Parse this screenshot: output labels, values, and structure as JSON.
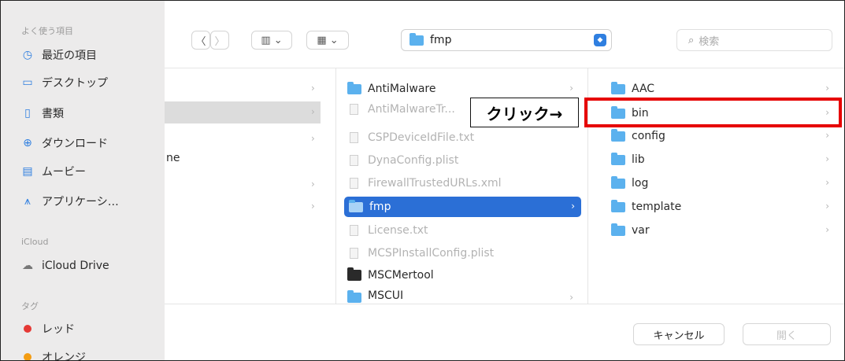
{
  "sidebar": {
    "favorites_header": "よく使う項目",
    "favorites": [
      {
        "label": "最近の項目",
        "icon": "clock-icon"
      },
      {
        "label": "デスクトップ",
        "icon": "desktop-icon"
      },
      {
        "label": "書類",
        "icon": "document-icon"
      },
      {
        "label": "ダウンロード",
        "icon": "download-icon"
      },
      {
        "label": "ムービー",
        "icon": "film-icon"
      },
      {
        "label": "アプリケーシ…",
        "icon": "applications-icon"
      }
    ],
    "icloud_header": "iCloud",
    "icloud": [
      {
        "label": "iCloud Drive",
        "icon": "cloud-icon"
      }
    ],
    "tags_header": "タグ",
    "tags": [
      {
        "label": "レッド",
        "color": "#e53935"
      },
      {
        "label": "オレンジ",
        "color": "#f39c12"
      }
    ]
  },
  "toolbar": {
    "back": "〈",
    "forward": "〉",
    "view_mode": "▥ ⌄",
    "group": "▦ ⌄",
    "path_value": "fmp",
    "search_placeholder": "検索"
  },
  "columns": {
    "col1_partial_label": "ne",
    "col2": [
      {
        "label": "AntiMalware",
        "type": "folder",
        "dim": false,
        "chevron": true
      },
      {
        "label": "AntiMalwareTr...",
        "type": "file",
        "dim": true
      },
      {
        "label": "CSPDeviceIdFile.txt",
        "type": "file",
        "dim": true
      },
      {
        "label": "DynaConfig.plist",
        "type": "file",
        "dim": true
      },
      {
        "label": "FirewallTrustedURLs.xml",
        "type": "file",
        "dim": true
      },
      {
        "label": "fmp",
        "type": "folder",
        "dim": false,
        "selected": true,
        "chevron": true
      },
      {
        "label": "License.txt",
        "type": "file",
        "dim": true
      },
      {
        "label": "MCSPInstallConfig.plist",
        "type": "file",
        "dim": true
      },
      {
        "label": "MSCMertool",
        "type": "exec",
        "dim": false
      },
      {
        "label": "MSCUI",
        "type": "folder",
        "dim": false,
        "chevron": true
      }
    ],
    "col3": [
      {
        "label": "AAC"
      },
      {
        "label": "bin"
      },
      {
        "label": "config"
      },
      {
        "label": "lib"
      },
      {
        "label": "log"
      },
      {
        "label": "template"
      },
      {
        "label": "var"
      }
    ]
  },
  "annotation": {
    "text": "クリック→",
    "box_color": "#e60000"
  },
  "footer": {
    "cancel": "キャンセル",
    "open": "開く"
  },
  "accent": "#2b6fd6"
}
